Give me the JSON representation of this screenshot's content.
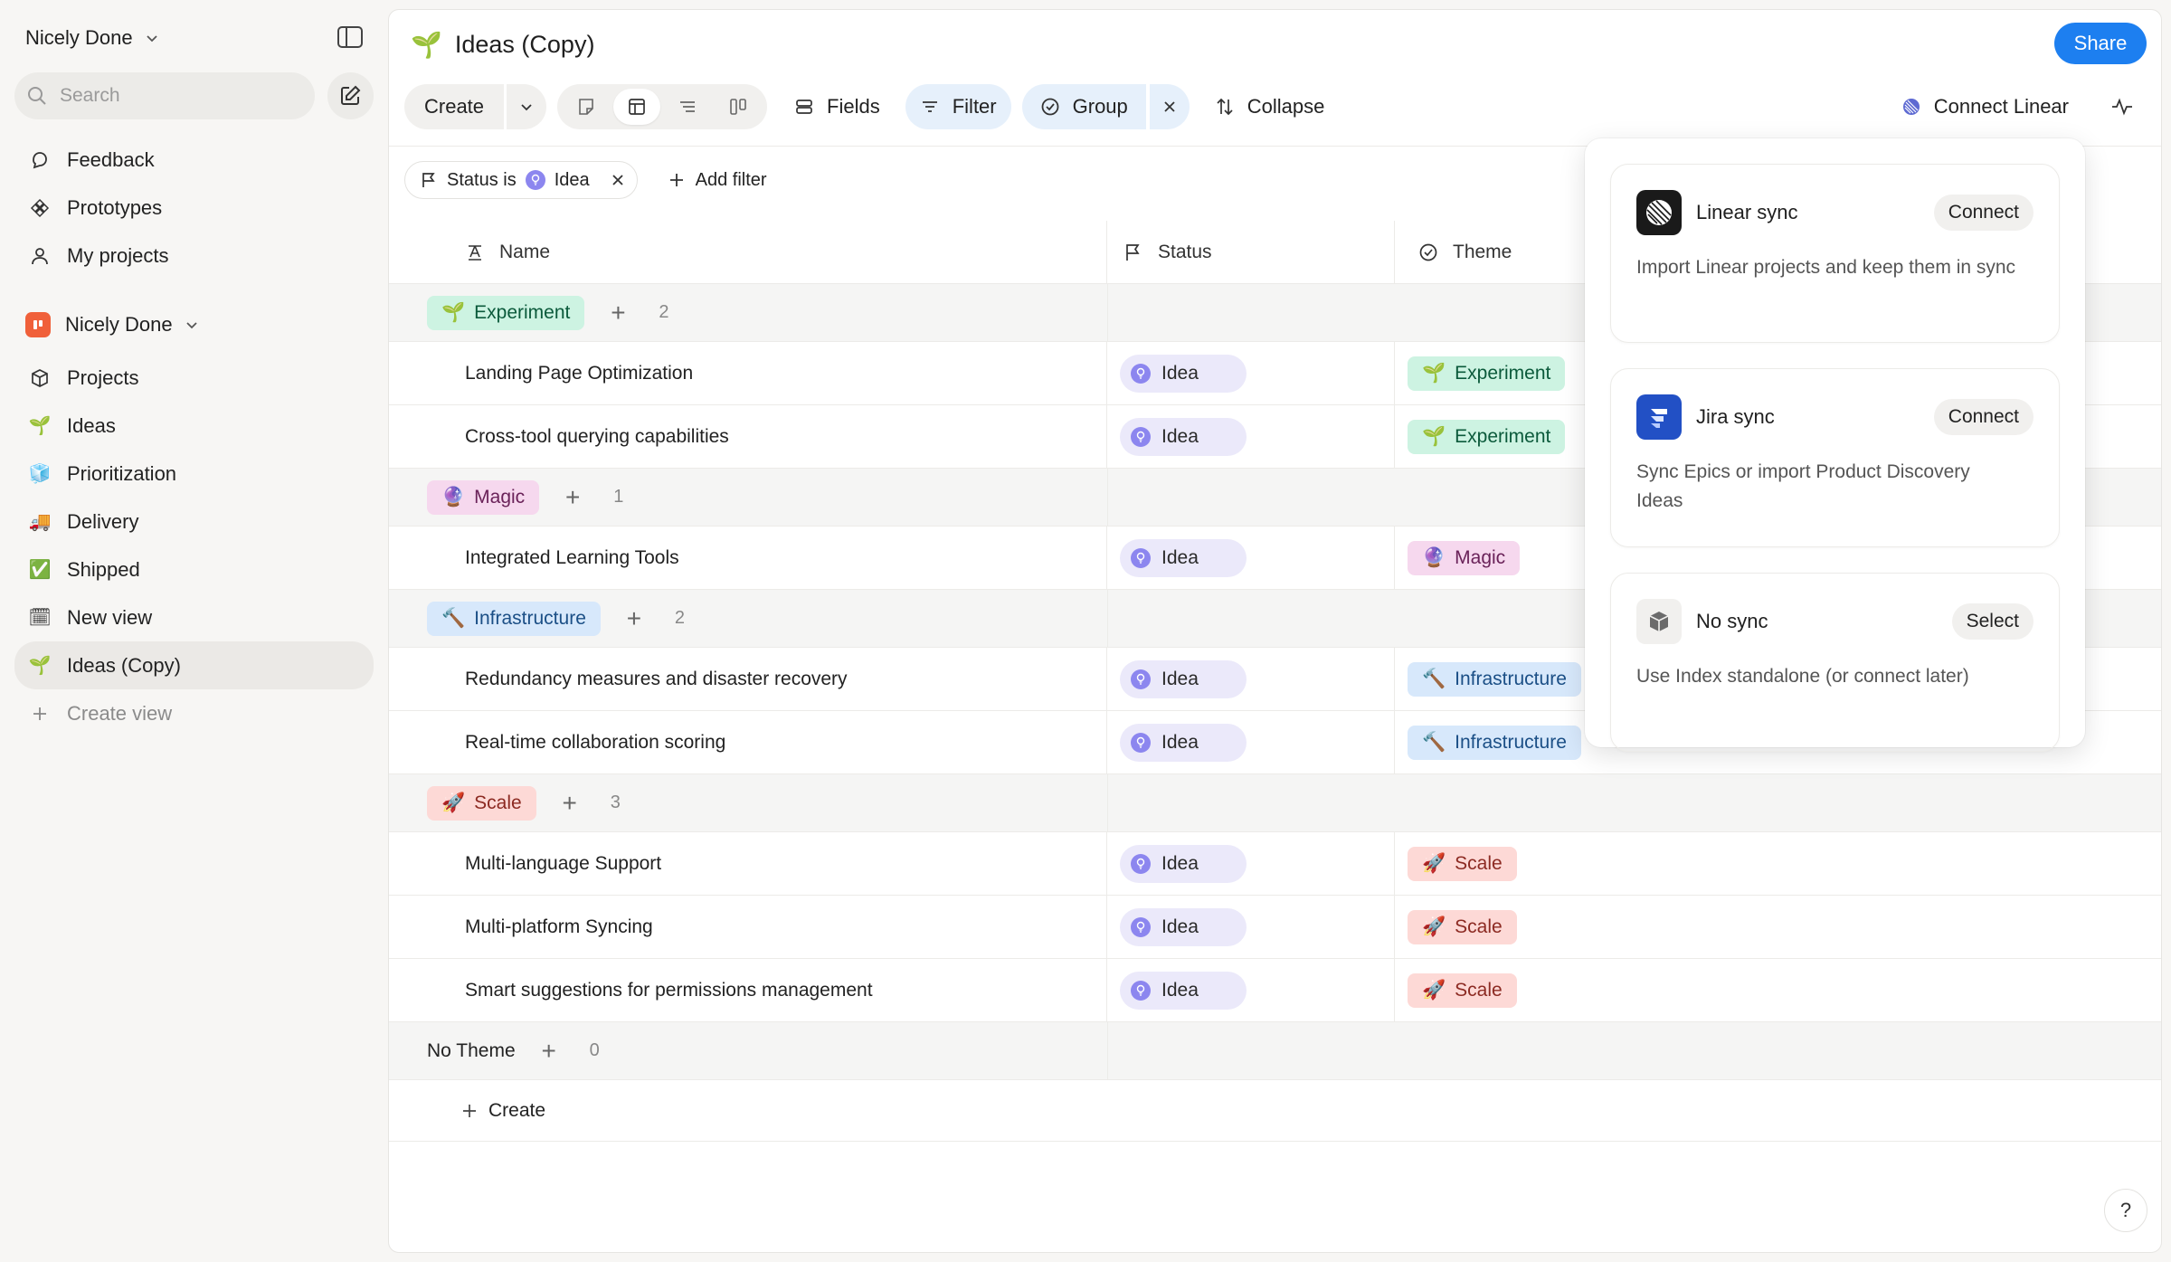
{
  "sidebar": {
    "workspace": "Nicely Done",
    "search_placeholder": "Search",
    "top_nav": [
      {
        "label": "Feedback",
        "icon": "feedback-icon"
      },
      {
        "label": "Prototypes",
        "icon": "prototypes-icon"
      },
      {
        "label": "My projects",
        "icon": "user-icon"
      }
    ],
    "team": "Nicely Done",
    "team_nav": [
      {
        "label": "Projects",
        "icon": "cube-icon"
      },
      {
        "label": "Ideas",
        "icon": "seedling-icon"
      },
      {
        "label": "Prioritization",
        "icon": "ice-icon"
      },
      {
        "label": "Delivery",
        "icon": "truck-icon"
      },
      {
        "label": "Shipped",
        "icon": "checkmark-icon"
      },
      {
        "label": "New view",
        "icon": "calendar-icon"
      },
      {
        "label": "Ideas (Copy)",
        "icon": "seedling-icon"
      },
      {
        "label": "Create view",
        "icon": "plus-icon"
      }
    ],
    "active_item": "Ideas (Copy)"
  },
  "header": {
    "title": "Ideas (Copy)",
    "share_label": "Share"
  },
  "toolbar": {
    "create_label": "Create",
    "fields_label": "Fields",
    "filter_label": "Filter",
    "group_label": "Group",
    "collapse_label": "Collapse",
    "connect_linear_label": "Connect Linear"
  },
  "filter": {
    "chip_field": "Status is",
    "chip_value": "Idea",
    "add_filter_label": "Add filter"
  },
  "table": {
    "columns": [
      "Name",
      "Status",
      "Theme"
    ],
    "groups": [
      {
        "theme": "Experiment",
        "icon": "🌱",
        "style": "exp",
        "count": "2",
        "rows": [
          {
            "name": "Landing Page Optimization",
            "status": "Idea",
            "theme": "Experiment"
          },
          {
            "name": "Cross-tool querying capabilities",
            "status": "Idea",
            "theme": "Experiment"
          }
        ]
      },
      {
        "theme": "Magic",
        "icon": "🔮",
        "style": "magic",
        "count": "1",
        "rows": [
          {
            "name": "Integrated Learning Tools",
            "status": "Idea",
            "theme": "Magic"
          }
        ]
      },
      {
        "theme": "Infrastructure",
        "icon": "🔨",
        "style": "infra",
        "count": "2",
        "rows": [
          {
            "name": "Redundancy measures and disaster recovery",
            "status": "Idea",
            "theme": "Infrastructure"
          },
          {
            "name": "Real-time collaboration scoring",
            "status": "Idea",
            "theme": "Infrastructure"
          }
        ]
      },
      {
        "theme": "Scale",
        "icon": "🚀",
        "style": "scale",
        "count": "3",
        "rows": [
          {
            "name": "Multi-language Support",
            "status": "Idea",
            "theme": "Scale"
          },
          {
            "name": "Multi-platform Syncing",
            "status": "Idea",
            "theme": "Scale"
          },
          {
            "name": "Smart suggestions for permissions management",
            "status": "Idea",
            "theme": "Scale"
          }
        ]
      }
    ],
    "no_theme": {
      "label": "No Theme",
      "count": "0"
    },
    "create_label": "Create"
  },
  "popover": {
    "cards": [
      {
        "title": "Linear sync",
        "button": "Connect",
        "desc": "Import Linear projects and keep them in sync",
        "logo": "linear-logo-icon"
      },
      {
        "title": "Jira sync",
        "button": "Connect",
        "desc": "Sync Epics or import Product Discovery Ideas",
        "logo": "jira-logo-icon"
      },
      {
        "title": "No sync",
        "button": "Select",
        "desc": "Use Index standalone (or connect later)",
        "logo": "box-icon"
      }
    ]
  },
  "help_label": "?",
  "colors": {
    "accent": "#1d7ff0",
    "idea": "#8c86ef",
    "experiment_bg": "#cdf3e2",
    "magic_bg": "#f6d8ee",
    "infrastructure_bg": "#d7e8fb",
    "scale_bg": "#fdd9d6"
  }
}
